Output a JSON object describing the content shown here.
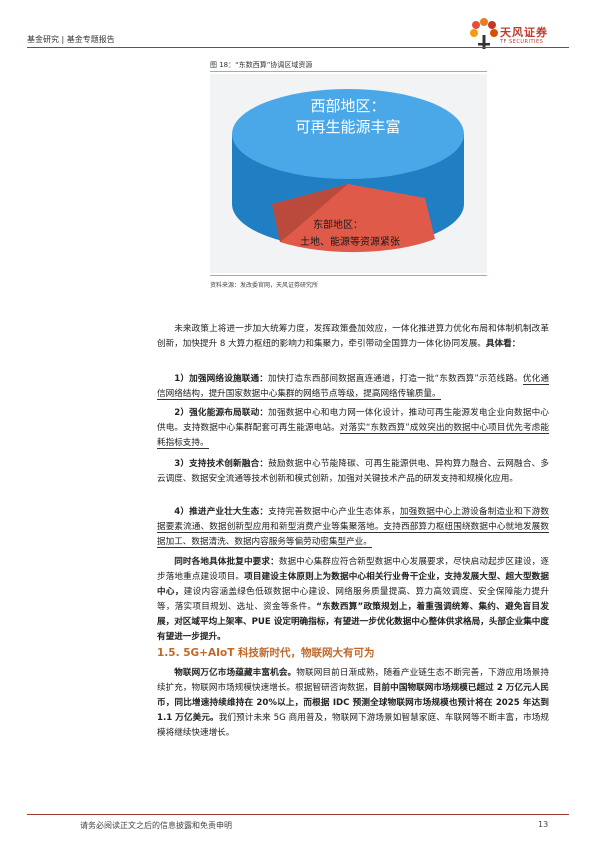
{
  "header": {
    "report_type": "基金研究 | 基金专题报告",
    "logo_cn": "天风证券",
    "logo_en": "TF SECURITIES"
  },
  "figure": {
    "title": "图 18：“东数西算”协调区域资源",
    "west_label_1": "西部地区：",
    "west_label_2": "可再生能源丰富",
    "east_label_1": "东部地区：",
    "east_label_2": "土地、能源等资源紧张",
    "source": "资料来源：发改委官网，天风证券研究所"
  },
  "body": {
    "intro": "未来政策上将进一步加大统筹力度，发挥政策叠加效应，一体化推进算力优化布局和体制机制改革创新，加快提升 8 大算力枢纽的影响力和集聚力，牵引带动全国算力一体化协同发展。",
    "intro_bold": "具体看：",
    "p1_bold": "1）加强网络设施联通：",
    "p1_a": "加快打造东西部间数据直连通道，打造一批“东数西算”示范线路。",
    "p1_b": "优化通信网络结构，提升国家数据中心集群的网络节点等级，提高网络传输质量。",
    "p2_bold": "2）强化能源布局联动：",
    "p2_a": "加强数据中心和电力网一体化设计，推动可再生能源发电企业向数据中心供电。支持数据中心集群配套可再生能源电站。",
    "p2_b": "对落实“东数西算”成效突出的数据中心项目优先考虑能耗指标支持。",
    "p3_bold": "3）支持技术创新融合：",
    "p3_a": "鼓励数据中心节能降碳、可再生能源供电、异构算力融合、云网融合、多云调度、数据安全流通等技术创新和模式创新，加强对关键技术产品的研发支持和规模化应用。",
    "p4_bold": "4）推进产业壮大生态：",
    "p4_a": "支持完善数据中心产业生态体系，",
    "p4_b": "加强数据中心上游设备制造业和下游数据要素流通、数据创新型应用和新型消费产业等集聚落地。支持西部算力枢纽围绕数据中心就地发展数据加工、数据清洗、数据内容服务等偏劳动密集型产业。",
    "p5_bold": "同时各地具体批复中要求：",
    "p5_a": "数据中心集群应符合新型数据中心发展要求，尽快启动起步区建设，逐步落地重点建设项目。",
    "p5_b": "项目建设主体原则上为数据中心相关行业骨干企业，支持发展大型、超大型数据中心，",
    "p5_c": "建设内容涵盖绿色低碳数据中心建设、网络服务质量提高、算力高效调度、安全保障能力提升等，落实项目规划、选址、资金等条件。",
    "p5_d": "“东数西算”政策规划上，着重强调统筹、集约、避免盲目发展，对区域平均上架率、PUE 设定明确指标，有望进一步优化数据中心整体供求格局，头部企业集中度有望进一步提升。",
    "section_title": "1.5. 5G+AIoT 科技新时代，物联网大有可为",
    "p6_bold": "物联网万亿市场蕴藏丰富机会。",
    "p6_a": "物联网目前日渐成熟，随着产业链生态不断完善，下游应用场景持续扩充，物联网市场规模快速增长。根据智研咨询数据，",
    "p6_b": "目前中国物联网市场规模已超过 2 万亿元人民币，同比增速持续维持在 20%以上，而根据 IDC 预测全球物联网市场规模也预计将在 2025 年达到 1.1 万亿美元。",
    "p6_c": "我们预计未来 5G 商用普及，物联网下游场景如智慧家庭、车联网等不断丰富，市场规模将继续快速增长。"
  },
  "footer": {
    "disclaimer": "请务必阅读正文之后的信息披露和免责申明",
    "page_number": "13"
  },
  "colors": {
    "brand_red": "#c0392b",
    "section_orange": "#c0692b",
    "cylinder_blue": "#2a8fd6",
    "slice_red": "#e74c3c"
  }
}
